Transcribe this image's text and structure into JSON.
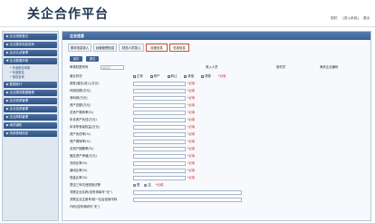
{
  "header": {
    "title": "关企合作平台",
    "links": [
      "您好,",
      "[进入系统]",
      "退出"
    ]
  },
  "sidebar": {
    "items": [
      {
        "label": "▶ 企业资质登记"
      },
      {
        "label": "▶ 企业基本信息查询"
      },
      {
        "label": "▶ 企业认证管理"
      },
      {
        "label": "▼ 企业数据申报"
      },
      {
        "label": "• 年度报告申报",
        "sub": true
      },
      {
        "label": "• 年度报告",
        "sub": true
      },
      {
        "label": "• 报告查询",
        "sub": true
      },
      {
        "label": "▶ 数据统计"
      },
      {
        "label": "▶ 企业报关数据管理"
      },
      {
        "label": "▶ 企业信用管理"
      },
      {
        "label": "▶ 企业自查管理"
      },
      {
        "label": "▶ 企业风险管理"
      },
      {
        "label": "▶ 海关通知"
      },
      {
        "label": "▶ 系统基础信息"
      }
    ]
  },
  "main": {
    "header": "企业信息",
    "tabs": [
      "基本信息录入",
      "经营管理信息",
      "财务人员录入",
      "经营信息",
      "信用信息"
    ],
    "active_tab": 3,
    "buttons": [
      "保存",
      "提交"
    ],
    "top_fields": {
      "code_label": "审核权限号码",
      "code_value": "填写值",
      "person_label": "录入人员",
      "org_label": "操作员",
      "org2_label": "海关企业编码"
    },
    "ops_label": "营业状况",
    "ops_options": [
      "正常",
      "停产",
      "转让",
      "其他",
      "清算"
    ],
    "fields": [
      "销售(营业)收入(万元)",
      "利润总额(万元)",
      "净利润(万元)",
      "资产总额(万元)",
      "总资产周转率(%)",
      "年末资产负债(万元)",
      "年末所有者权益(万元)",
      "资产负债率(%)",
      "资产周转率(%)",
      "总资产报酬率(%)",
      "固定资产净值(万元)",
      "流动比率(%)",
      "速动比率(%)",
      "现金比率(%)"
    ],
    "required_label": "*必填",
    "special_label": "是否三年内违规违法等",
    "special_options": [
      "是",
      "否"
    ],
    "last_fields": [
      "关联企业名称(没有请填写“无”)",
      "关联企业注册号/统一社会信用代码",
      "代码(没有请填写“无”)"
    ]
  }
}
